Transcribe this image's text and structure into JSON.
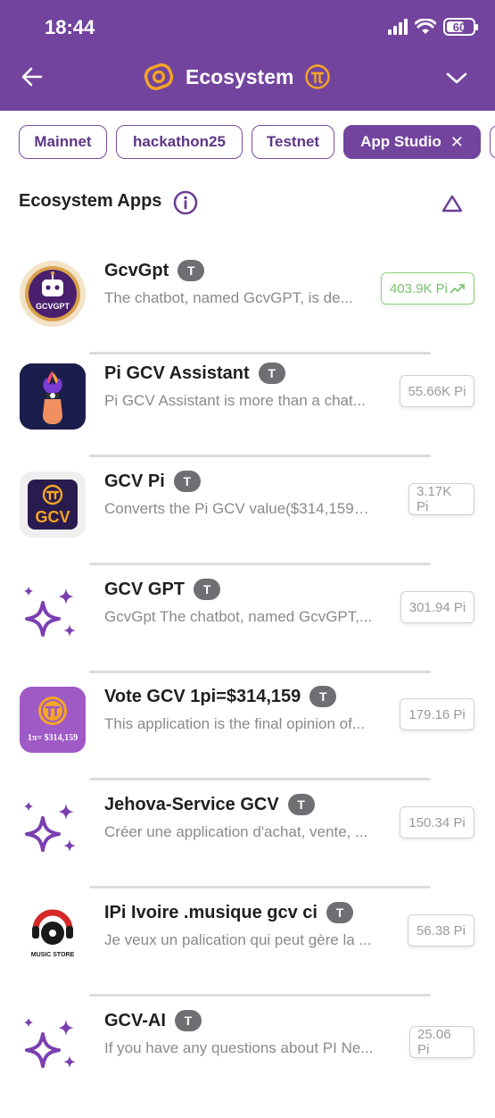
{
  "status_bar": {
    "time": "18:44",
    "battery": "60"
  },
  "header": {
    "title": "Ecosystem"
  },
  "chips": [
    {
      "label": "Mainnet"
    },
    {
      "label": "hackathon25"
    },
    {
      "label": "Testnet"
    },
    {
      "label": "App Studio",
      "close": "✕"
    }
  ],
  "section": {
    "title": "Ecosystem Apps"
  },
  "badge_label": "T",
  "apps": [
    {
      "name": "GcvGpt",
      "desc": "The chatbot, named GcvGPT, is de...",
      "price": "403.9K Pi",
      "icon": "gcvgpt-logo-icon",
      "logo_text": "GCVGPT"
    },
    {
      "name": "Pi GCV Assistant",
      "desc": "Pi GCV Assistant is more than a chat...",
      "price": "55.66K Pi",
      "icon": "torch-icon"
    },
    {
      "name": "GCV Pi",
      "desc": "Converts the Pi GCV value($314,159) ...",
      "price": "3.17K Pi",
      "icon": "pi-gcv-icon",
      "logo_text": "GCV"
    },
    {
      "name": "GCV GPT",
      "desc": "GcvGpt The chatbot, named GcvGPT,...",
      "price": "301.94 Pi",
      "icon": "sparkles-icon"
    },
    {
      "name": "Vote GCV 1pi=$314,159",
      "desc": "This application is the final opinion of...",
      "price": "179.16 Pi",
      "icon": "vote-gcv-icon",
      "logo_text": "1π= $314,159"
    },
    {
      "name": "Jehova-Service GCV",
      "desc": "Créer une application d'achat, vente, ...",
      "price": "150.34 Pi",
      "icon": "sparkles-icon"
    },
    {
      "name": "IPi Ivoire .musique gcv ci",
      "desc": "Je veux un palication qui peut gère la ...",
      "price": "56.38 Pi",
      "icon": "music-store-icon",
      "logo_text": "MUSIC STORE"
    },
    {
      "name": "GCV-AI",
      "desc": "If you have any questions about PI Ne...",
      "price": "25.06 Pi",
      "icon": "sparkles-icon"
    }
  ],
  "colors": {
    "header": "#73449e",
    "accent": "#7b4ba6",
    "badge": "#6f6f73",
    "trending": "#79c06a",
    "icon_orange": "#f5a623"
  }
}
